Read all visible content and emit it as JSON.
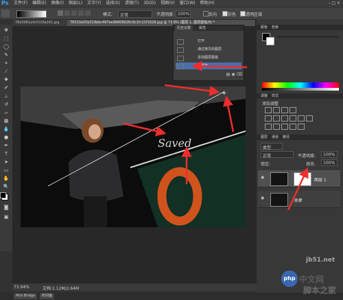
{
  "menubar": {
    "logo": "Ps",
    "items": [
      "文件(F)",
      "编辑(E)",
      "图像(I)",
      "图层(L)",
      "文字(Y)",
      "选择(S)",
      "滤镜(T)",
      "3D(D)",
      "视图(V)",
      "窗口(W)",
      "帮助(H)"
    ]
  },
  "options": {
    "mode_label": "模式:",
    "mode_value": "正常",
    "opacity_label": "不透明度:",
    "opacity_value": "100%",
    "reverse_label": "反向",
    "dither_label": "仿色",
    "transparency_label": "透明区域"
  },
  "tabs": [
    {
      "label": "78e0981a4c510fa261.jpg"
    },
    {
      "label": "78310a55b319ebc497ee99908026c9c1fc11f1626.jpg @ 73.9% (图层 1, 图层蒙版/8) *"
    }
  ],
  "history_panel": {
    "tab_history": "历史记录",
    "tab_properties": "属性",
    "items": [
      "打开",
      "通过拷贝的图层",
      "添加图层蒙版",
      "马赛克"
    ],
    "selected_index": 3
  },
  "right_panels": {
    "color_tab": "颜色",
    "swatches_tab": "色板",
    "adjust_tab": "调整",
    "styles_tab": "样式",
    "adjust_title": "添加调整",
    "layers_tab": "图层",
    "channels_tab": "通道",
    "paths_tab": "路径",
    "kind_label": "类型",
    "blend_mode": "正常",
    "opacity_label": "不透明度:",
    "opacity_value": "100%",
    "lock_label": "锁定:",
    "fill_label": "填充:",
    "fill_value": "100%"
  },
  "layers": [
    {
      "name": "图层 1"
    },
    {
      "name": "背景"
    }
  ],
  "status": {
    "zoom": "73.94%",
    "doc": "文档:1.12M/2.64M"
  },
  "bottom": {
    "minibridge": "Mini Bridge",
    "timeline": "时间轴"
  },
  "watermark": {
    "site": "jb51.net",
    "logo": "php",
    "cn": "中文网",
    "brand": "脚本之家"
  },
  "colors": {
    "annotation_arrow": "#ef2d2d",
    "selection_blue": "#4a6ea9",
    "ps_blue": "#31a8ff"
  }
}
